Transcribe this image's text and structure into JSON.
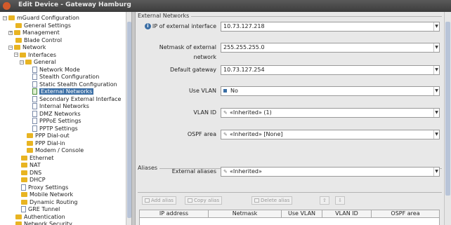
{
  "window": {
    "title": "Edit Device - Gateway Hamburg"
  },
  "tree": {
    "items": [
      {
        "label": "mGuard Configuration",
        "indent": 1,
        "kind": "folder",
        "toggle": "−"
      },
      {
        "label": "General Settings",
        "indent": 2,
        "kind": "folder",
        "toggle": ""
      },
      {
        "label": "Management",
        "indent": 2,
        "kind": "folder",
        "toggle": "+"
      },
      {
        "label": "Blade Control",
        "indent": 2,
        "kind": "folder",
        "toggle": ""
      },
      {
        "label": "Network",
        "indent": 2,
        "kind": "folder",
        "toggle": "−"
      },
      {
        "label": "Interfaces",
        "indent": 3,
        "kind": "folder",
        "toggle": "−"
      },
      {
        "label": "General",
        "indent": 4,
        "kind": "folder",
        "toggle": "−"
      },
      {
        "label": "Network Mode",
        "indent": 5,
        "kind": "page",
        "toggle": ""
      },
      {
        "label": "Stealth Configuration",
        "indent": 5,
        "kind": "page",
        "toggle": ""
      },
      {
        "label": "Static Stealth Configuration",
        "indent": 5,
        "kind": "page",
        "toggle": ""
      },
      {
        "label": "External Networks",
        "indent": 5,
        "kind": "page-ok",
        "toggle": "",
        "selected": true
      },
      {
        "label": "Secondary External Interface",
        "indent": 5,
        "kind": "page",
        "toggle": ""
      },
      {
        "label": "Internal Networks",
        "indent": 5,
        "kind": "page",
        "toggle": ""
      },
      {
        "label": "DMZ Networks",
        "indent": 5,
        "kind": "page",
        "toggle": ""
      },
      {
        "label": "PPPoE Settings",
        "indent": 5,
        "kind": "page",
        "toggle": ""
      },
      {
        "label": "PPTP Settings",
        "indent": 5,
        "kind": "page",
        "toggle": ""
      },
      {
        "label": "PPP Dial-out",
        "indent": 4,
        "kind": "folder",
        "toggle": ""
      },
      {
        "label": "PPP Dial-in",
        "indent": 4,
        "kind": "folder",
        "toggle": ""
      },
      {
        "label": "Modem / Console",
        "indent": 4,
        "kind": "folder",
        "toggle": ""
      },
      {
        "label": "Ethernet",
        "indent": 3,
        "kind": "folder",
        "toggle": ""
      },
      {
        "label": "NAT",
        "indent": 3,
        "kind": "folder",
        "toggle": ""
      },
      {
        "label": "DNS",
        "indent": 3,
        "kind": "folder",
        "toggle": ""
      },
      {
        "label": "DHCP",
        "indent": 3,
        "kind": "folder",
        "toggle": ""
      },
      {
        "label": "Proxy Settings",
        "indent": 3,
        "kind": "page",
        "toggle": ""
      },
      {
        "label": "Mobile Network",
        "indent": 3,
        "kind": "folder",
        "toggle": ""
      },
      {
        "label": "Dynamic Routing",
        "indent": 3,
        "kind": "folder",
        "toggle": ""
      },
      {
        "label": "GRE Tunnel",
        "indent": 3,
        "kind": "page",
        "toggle": ""
      },
      {
        "label": "Authentication",
        "indent": 2,
        "kind": "folder",
        "toggle": ""
      },
      {
        "label": "Network Security",
        "indent": 2,
        "kind": "folder",
        "toggle": ""
      }
    ]
  },
  "main": {
    "section_title": "External Networks",
    "fields": [
      {
        "label": "IP of external interface",
        "value": "10.73.127.218",
        "marker": "",
        "info": true
      },
      {
        "label": "Netmask of external network",
        "value": "255.255.255.0",
        "marker": "",
        "info": false
      },
      {
        "label": "Default gateway",
        "value": "10.73.127.254",
        "marker": "",
        "info": false
      },
      {
        "label": "Use VLAN",
        "value": "No",
        "marker": "blue",
        "info": false
      },
      {
        "label": "VLAN ID",
        "value": "«Inherited» (1)",
        "marker": "inherited",
        "info": false
      },
      {
        "label": "OSPF area",
        "value": "«Inherited» [None]",
        "marker": "inherited",
        "info": false
      }
    ],
    "aliases_title": "Aliases",
    "external_aliases": {
      "label": "External aliases",
      "value": "«Inherited»",
      "marker": "inherited"
    },
    "toolbar": {
      "add_alias": "Add alias",
      "copy_alias": "Copy alias",
      "delete_alias": "Delete alias",
      "move_up": "⇧",
      "move_down": "⇩"
    },
    "table_columns": [
      "IP address",
      "Netmask",
      "Use VLAN",
      "VLAN ID",
      "OSPF area"
    ]
  }
}
